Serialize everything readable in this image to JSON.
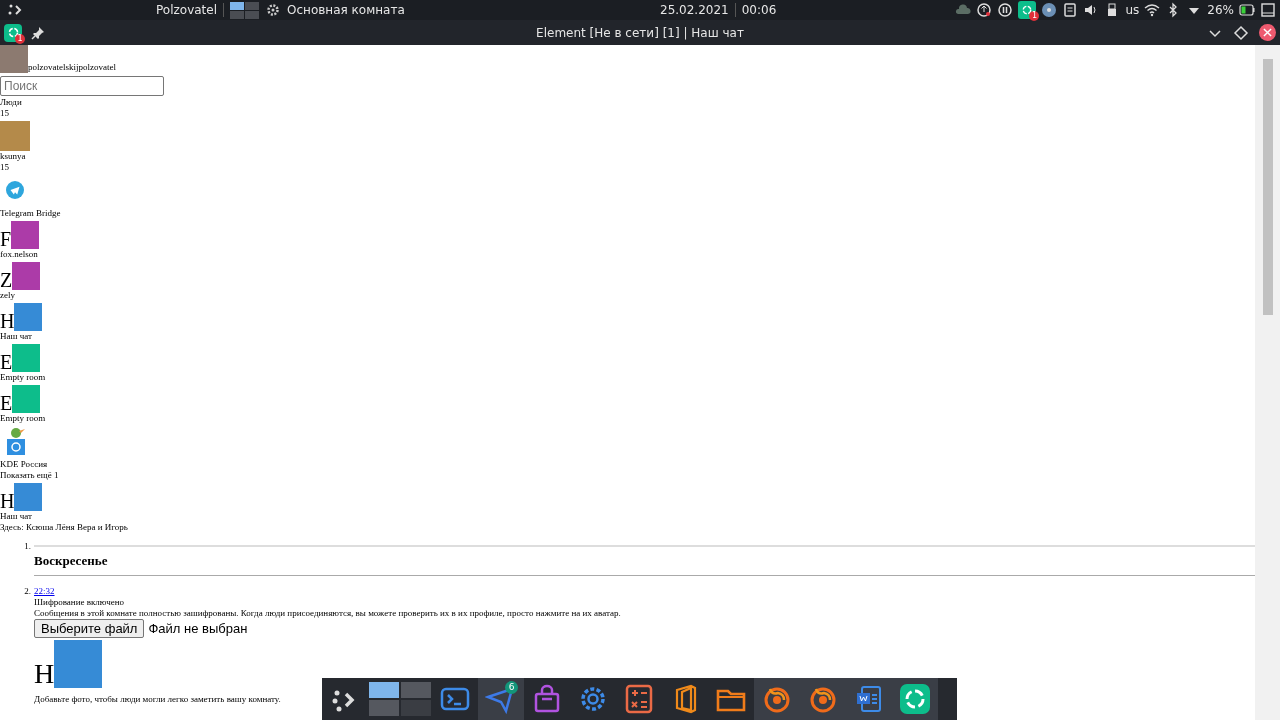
{
  "top_panel": {
    "user": "Polzovatel",
    "pager": [
      {
        "selected": true
      },
      {
        "selected": false
      },
      {
        "selected": false
      },
      {
        "selected": false
      }
    ],
    "active_window": "Основная комната",
    "date": "25.02.2021",
    "time": "00:06",
    "tray": [
      {
        "kind": "cloud"
      },
      {
        "kind": "update"
      },
      {
        "kind": "pause"
      },
      {
        "kind": "element",
        "badge": "1"
      },
      {
        "kind": "disk"
      },
      {
        "kind": "clipboard"
      },
      {
        "kind": "volume"
      },
      {
        "kind": "usb"
      },
      {
        "kind": "text",
        "text": "us"
      },
      {
        "kind": "wifi"
      },
      {
        "kind": "bluetooth"
      },
      {
        "kind": "expand"
      },
      {
        "kind": "text",
        "text": "26%"
      },
      {
        "kind": "battery"
      },
      {
        "kind": "desktop"
      }
    ]
  },
  "window": {
    "title": "Element [Не в сети] [1] | Наш чат",
    "app_badge": "1"
  },
  "sidebar": {
    "user_name": "polzovatelskijpolzovatel",
    "search": {
      "placeholder": "Поиск"
    },
    "section": {
      "title": "Люди",
      "count": "15"
    },
    "rooms": [
      {
        "kind": "photo",
        "name": "ksunya",
        "count": "15"
      },
      {
        "kind": "telegram",
        "name": "Telegram Bridge"
      },
      {
        "kind": "letter",
        "letter": "F",
        "color": "#ac3ba8",
        "name": "fox.nelson"
      },
      {
        "kind": "letter",
        "letter": "Z",
        "color": "#ac3ba8",
        "name": "zely"
      },
      {
        "kind": "letter",
        "letter": "Н",
        "color": "#368bd6",
        "name": "Наш чат"
      },
      {
        "kind": "letter",
        "letter": "E",
        "color": "#0dbd8b",
        "name": "Empty room"
      },
      {
        "kind": "letter",
        "letter": "E",
        "color": "#0dbd8b",
        "name": "Empty room"
      },
      {
        "kind": "kde",
        "name": "KDE Россия"
      }
    ],
    "show_more": "Показать ещё 1"
  },
  "room_header": {
    "letter": "Н",
    "name": "Наш чат",
    "topic": "Здесь: Ксюша Лёня Вера и Игорь"
  },
  "timeline": [
    {
      "kind": "date",
      "number": "1.",
      "text": "Воскресенье"
    },
    {
      "kind": "event",
      "number": "2.",
      "time": "22:32",
      "title": "Шифрование включено",
      "text": "Сообщения в этой комнате полностью зашифрованы. Когда люди присоединяются, вы можете проверить их в их профиле, просто нажмите на их аватар.",
      "file_button": "Выберите файл",
      "file_status": "Файл не выбран",
      "letter": "Н",
      "hint": "Добавьте фото, чтобы люди могли легко заметить вашу комнату."
    }
  ],
  "dock": [
    {
      "kind": "launcher",
      "active": false
    },
    {
      "kind": "pager",
      "active": false
    },
    {
      "kind": "terminal",
      "active": false
    },
    {
      "kind": "messenger",
      "active": true,
      "badge": "6"
    },
    {
      "kind": "store",
      "active": false
    },
    {
      "kind": "settings",
      "active": false
    },
    {
      "kind": "calculator",
      "active": false
    },
    {
      "kind": "office",
      "active": false
    },
    {
      "kind": "folder",
      "active": false
    },
    {
      "kind": "firefox",
      "active": true
    },
    {
      "kind": "firefox",
      "active": true
    },
    {
      "kind": "document",
      "active": true
    },
    {
      "kind": "element",
      "active": true
    }
  ]
}
